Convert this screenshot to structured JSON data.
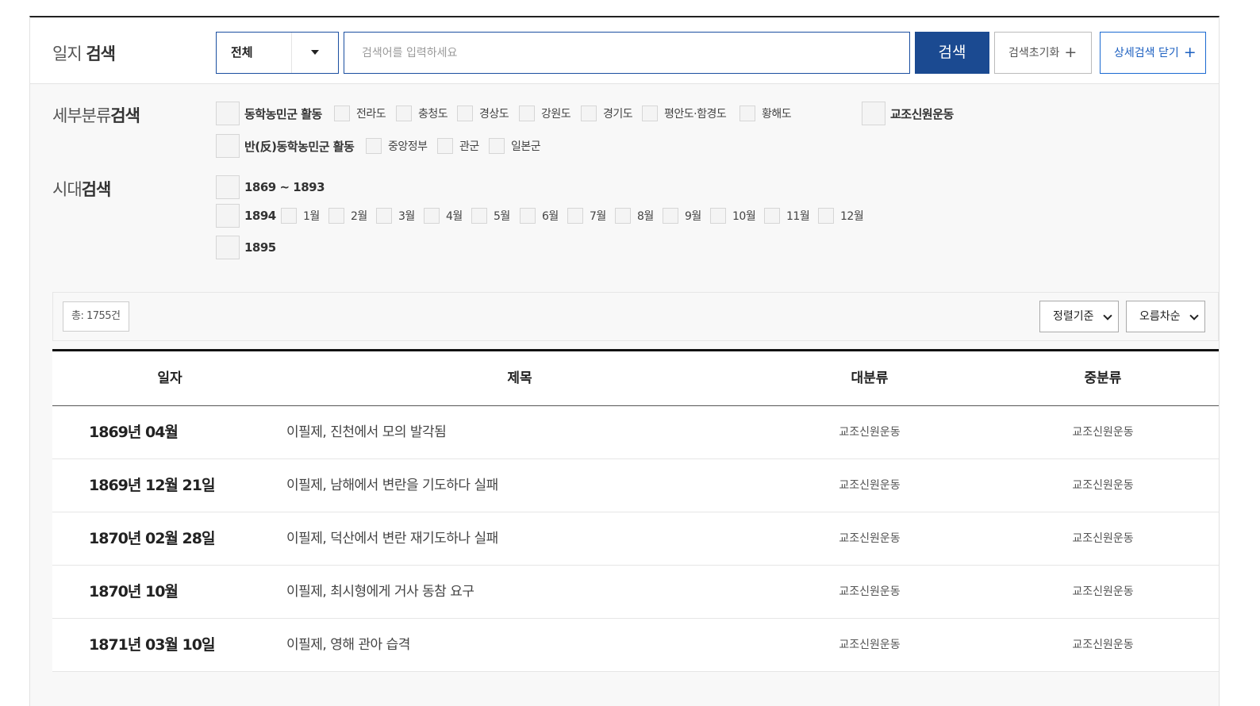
{
  "search": {
    "label_light": "일지",
    "label_bold": "검색",
    "scope_value": "전체",
    "placeholder": "검색어를 입력하세요",
    "search_button": "검색",
    "reset_button": "검색초기화",
    "detail_button": "상세검색 닫기"
  },
  "category_filter": {
    "label_light": "세부분류",
    "label_bold": "검색",
    "row1": [
      {
        "label": "동학농민군 활동",
        "strong": true
      },
      {
        "label": "전라도"
      },
      {
        "label": "충청도"
      },
      {
        "label": "경상도"
      },
      {
        "label": "강원도"
      },
      {
        "label": "경기도"
      },
      {
        "label": "평안도·함경도"
      },
      {
        "label": "황해도"
      },
      {
        "label": "교조신원운동",
        "strong": true
      }
    ],
    "row2": [
      {
        "label": "반(反)동학농민군 활동",
        "strong": true
      },
      {
        "label": "중앙정부"
      },
      {
        "label": "관군"
      },
      {
        "label": "일본군"
      }
    ]
  },
  "period_filter": {
    "label_light": "시대",
    "label_bold": "검색",
    "range": "1869 ~ 1893",
    "year_1894": "1894",
    "months": [
      "1월",
      "2월",
      "3월",
      "4월",
      "5월",
      "6월",
      "7월",
      "8월",
      "9월",
      "10월",
      "11월",
      "12월"
    ],
    "year_1895": "1895"
  },
  "results": {
    "total": "총: 1755건",
    "sort_by": "정렬기준",
    "sort_order": "오름차순"
  },
  "table": {
    "headers": [
      "일자",
      "제목",
      "대분류",
      "중분류"
    ],
    "rows": [
      {
        "date": "1869년 04월",
        "title": "이필제, 진천에서 모의 발각됨",
        "cat1": "교조신원운동",
        "cat2": "교조신원운동"
      },
      {
        "date": "1869년 12월 21일",
        "title": "이필제, 남해에서 변란을 기도하다 실패",
        "cat1": "교조신원운동",
        "cat2": "교조신원운동"
      },
      {
        "date": "1870년 02월 28일",
        "title": "이필제, 덕산에서 변란 재기도하나 실패",
        "cat1": "교조신원운동",
        "cat2": "교조신원운동"
      },
      {
        "date": "1870년 10월",
        "title": "이필제, 최시형에게 거사 동참 요구",
        "cat1": "교조신원운동",
        "cat2": "교조신원운동"
      },
      {
        "date": "1871년 03월 10일",
        "title": "이필제, 영해 관아 습격",
        "cat1": "교조신원운동",
        "cat2": "교조신원운동"
      }
    ]
  }
}
